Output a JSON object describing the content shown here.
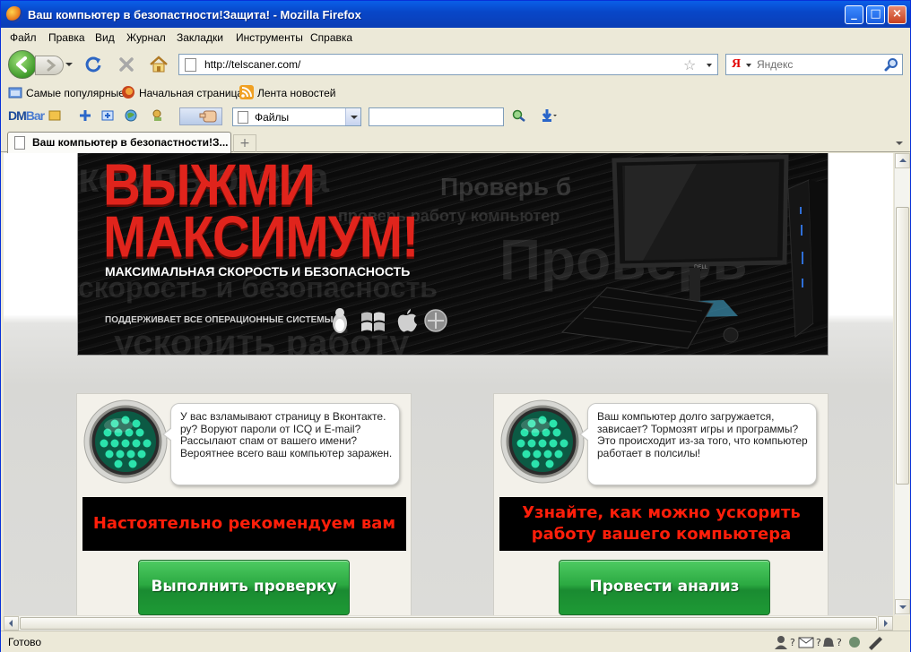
{
  "window": {
    "title": "Ваш компьютер в безопастности!Защита! - Mozilla Firefox",
    "controls": {
      "minimize": "_",
      "maximize": "□",
      "close": "×"
    }
  },
  "menu": [
    "Файл",
    "Правка",
    "Вид",
    "Журнал",
    "Закладки",
    "Инструменты",
    "Справка"
  ],
  "nav": {
    "url": "http://telscaner.com/",
    "search_placeholder": "Яндекс",
    "search_engine_letter": "Я"
  },
  "bookmarks": [
    "Самые популярные",
    "Начальная страница",
    "Лента новостей"
  ],
  "dmbar": {
    "logo_dm": "DM",
    "logo_bar": "Bar",
    "select_value": "Файлы",
    "input_value": ""
  },
  "tabs": [
    {
      "label": "Ваш компьютер в безопастности!З..."
    }
  ],
  "newtab_symbol": "+",
  "banner": {
    "headline_1": "ВЫЖМИ",
    "headline_2": "МАКСИМУМ!",
    "subtitle": "МАКСИМАЛЬНАЯ СКОРОСТЬ И БЕЗОПАСНОСТЬ",
    "os_note": "ПОДДЕРЖИВАЕТ ВСЕ ОПЕРАЦИОННЫЕ СИСТЕМЫ",
    "brand": "DELL",
    "bg_words": [
      "компьютера",
      "Проверь б",
      "проверь работу компьютер",
      "Проверь",
      "скорость и безопасность",
      "ускорить работу"
    ]
  },
  "boxes": [
    {
      "text": "У вас взламывают страницу в Вконтакте. ру? Воруют пароли от ICQ и E-mail? Рассылают спам от вашего имени? Вероятнее всего ваш компьютер заражен.",
      "cta": "Настоятельно рекомендуем вам",
      "button": "Выполнить проверку"
    },
    {
      "text": "Ваш компьютер долго загружается, зависает? Тормозят игры и программы? Это происходит из-за того, что компьютер работает в полсилы!",
      "cta": "Узнайте, как можно ускорить работу вашего компьютера",
      "button": "Провести анализ"
    }
  ],
  "status": {
    "text": "Готово"
  },
  "colors": {
    "titlebar": "#0a50d8",
    "headline_red": "#e0241c",
    "cta_red": "#ff1e0a",
    "button_green": "#2ba941",
    "led_green": "#1fd39a"
  },
  "icons": [
    "firefox-icon",
    "back-arrow-icon",
    "forward-arrow-icon",
    "reload-icon",
    "stop-icon",
    "home-icon",
    "bookmark-star-icon",
    "search-magnifier-icon",
    "rss-icon",
    "linux-tux-icon",
    "windows-logo-icon",
    "apple-logo-icon",
    "security-light-icon"
  ]
}
